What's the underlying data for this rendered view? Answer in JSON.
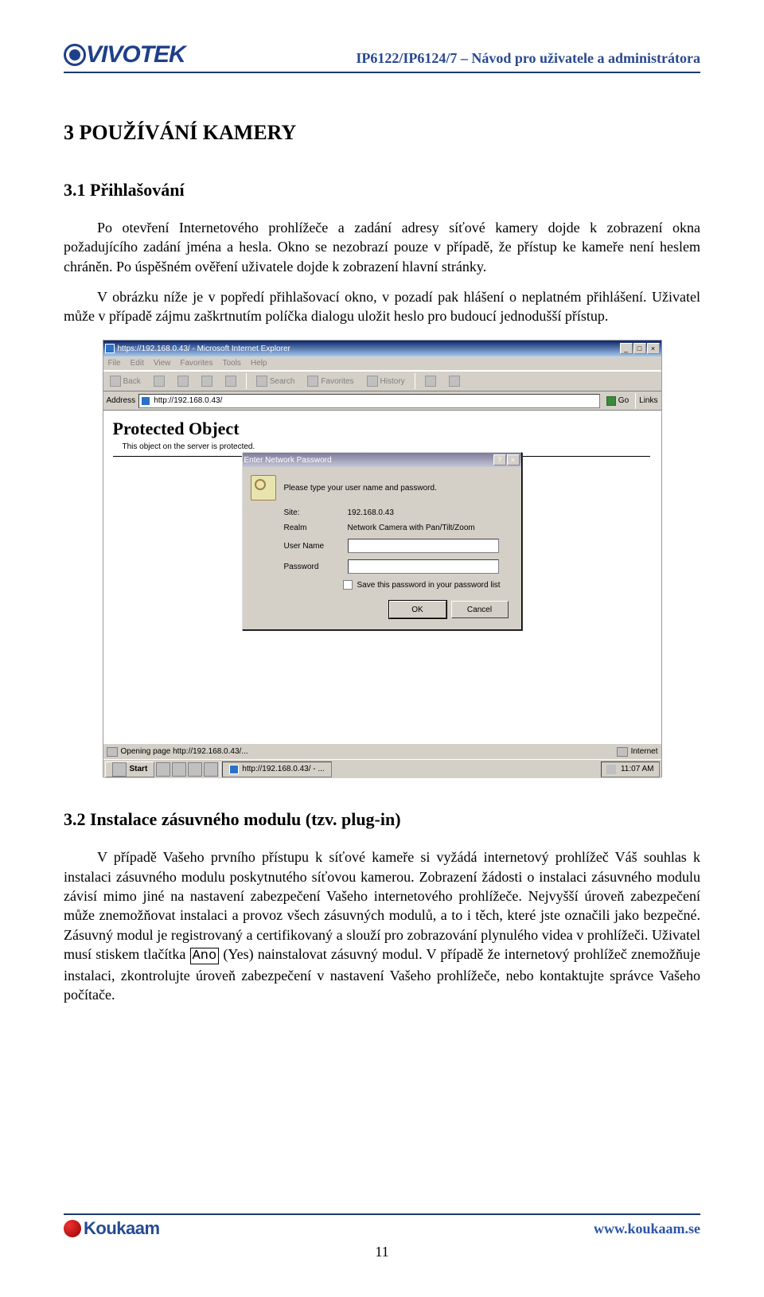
{
  "header": {
    "logo_text": "VIVOTEK",
    "doc_title": "IP6122/IP6124/7 – Návod pro uživatele a administrátora"
  },
  "section3": {
    "heading": "3   POUŽÍVÁNÍ KAMERY",
    "s31_heading": "3.1   Přihlašování",
    "p1": "Po otevření Internetového prohlížeče a zadání adresy síťové kamery dojde k zobrazení okna požadujícího zadání jména a hesla. Okno se nezobrazí pouze v případě, že přístup ke kameře není heslem chráněn. Po úspěšném ověření uživatele dojde k zobrazení hlavní stránky.",
    "p2": "V obrázku níže je v popředí přihlašovací okno, v pozadí pak hlášení o neplatném přihlášení. Uživatel může v případě zájmu zaškrtnutím políčka dialogu uložit heslo pro budoucí jednodušší přístup.",
    "s32_heading": "3.2   Instalace zásuvného modulu (tzv. plug-in)",
    "p3_before": "V případě Vašeho prvního přístupu k síťové kameře si vyžádá internetový prohlížeč Váš souhlas k instalaci zásuvného modulu poskytnutého síťovou kamerou. Zobrazení žádosti o instalaci zásuvného modulu závisí mimo jiné na nastavení zabezpečení Vašeho internetového prohlížeče. Nejvyšší úroveň zabezpečení může znemožňovat instalaci a provoz všech zásuvných modulů,  a to i těch, které jste označili jako bezpečné. Zásuvný modul je registrovaný a certifikovaný a slouží pro zobrazování plynulého videa v prohlížeči. Uživatel musí stiskem tlačítka ",
    "p3_button": "Ano",
    "p3_after": " (Yes) nainstalovat zásuvný modul. V případě že internetový prohlížeč znemožňuje instalaci, zkontrolujte úroveň zabezpečení v nastavení Vašeho prohlížeče, nebo kontaktujte správce Vašeho počítače."
  },
  "screenshot": {
    "window_title": "https://192.168.0.43/ - Microsoft Internet Explorer",
    "menu": {
      "file": "File",
      "edit": "Edit",
      "view": "View",
      "fav": "Favorites",
      "tools": "Tools",
      "help": "Help"
    },
    "toolbar": {
      "back": "Back",
      "search": "Search",
      "favorites": "Favorites",
      "history": "History"
    },
    "address_label": "Address",
    "address_value": "http://192.168.0.43/",
    "go": "Go",
    "links": "Links",
    "protected_title": "Protected Object",
    "protected_sub": "This object on the server is protected.",
    "dialog": {
      "title": "Enter Network Password",
      "prompt": "Please type your user name and password.",
      "site_label": "Site:",
      "site_value": "192.168.0.43",
      "realm_label": "Realm",
      "realm_value": "Network Camera with Pan/Tilt/Zoom",
      "user_label": "User Name",
      "pass_label": "Password",
      "save_label": "Save this password in your password list",
      "ok": "OK",
      "cancel": "Cancel"
    },
    "status": "Opening page http://192.168.0.43/...",
    "internet": "Internet",
    "start": "Start",
    "task_item": "http://192.168.0.43/ - ...",
    "clock": "11:07 AM"
  },
  "footer": {
    "brand": "Koukaam",
    "url": "www.koukaam.se",
    "page": "11"
  }
}
